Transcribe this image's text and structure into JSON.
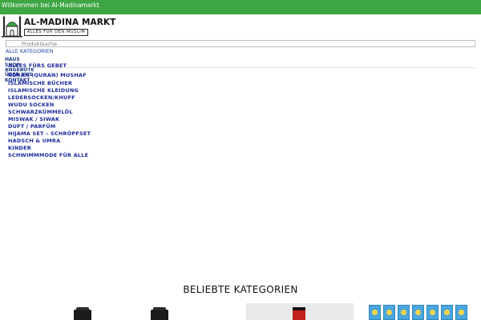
{
  "topbar": {
    "welcome": "Willkommen bei Al-Madinamarkt",
    "bg_color": "#3da543"
  },
  "logo": {
    "name": "AL-MADINA MARKT",
    "tagline": "ALLES FÜR DEN MUSLIM",
    "icon": "mosque-icon"
  },
  "search": {
    "placeholder": "Produktsuche"
  },
  "all_categories_label": "ALLE KATEGORIEN",
  "nav": [
    "HAUS",
    "SHOP",
    "ANGEBOTE",
    "ÜBER UNS",
    "KONTAKT"
  ],
  "categories": [
    "ALLES FÜRS GEBET",
    "KORAN (QURAN) MUSHAF",
    "ISLAMISCHE BÜCHER",
    "ISLAMISCHE KLEIDUNG",
    "LEDERSOCKEN/KHUFF",
    "WUDU SOCKEN",
    "SCHWARZKÜMMELÖL",
    "MISWAK / SIWAK",
    "DUFT / PARFÜM",
    "HIJAMA SET – SCHRÖPFSET",
    "HADSCH & UMRA",
    "KINDER",
    "SCHWIMMMODE FÜR ALLE"
  ],
  "section_title": "BELIEBTE KATEGORIEN",
  "colors": {
    "link": "#1d2a9e",
    "accent": "#3da543"
  }
}
